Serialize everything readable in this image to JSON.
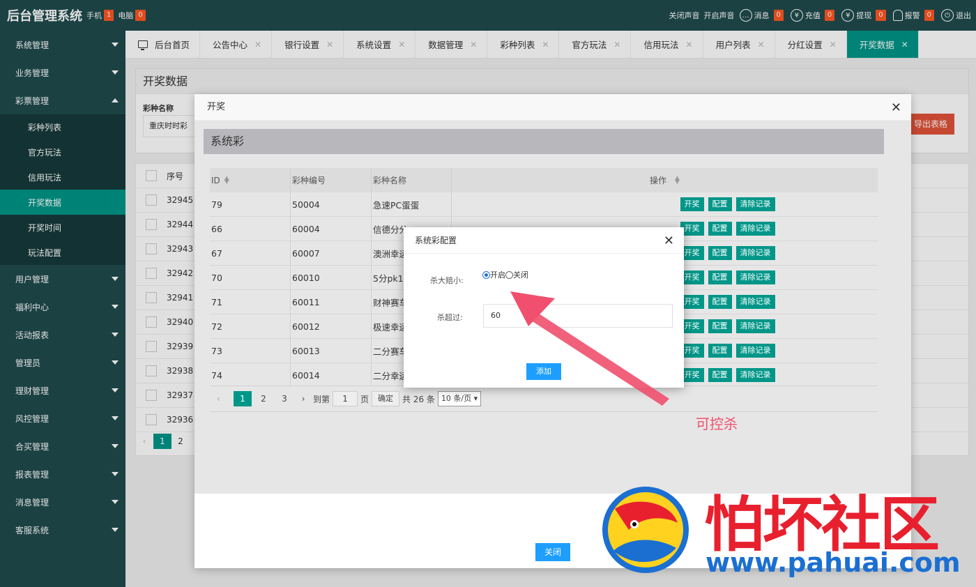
{
  "app": {
    "title": "后台管理系统",
    "mobile_label": "手机",
    "mobile_count": "1",
    "pc_label": "电脑",
    "pc_count": "0"
  },
  "topright": {
    "sound_off": "关闭声音",
    "sound_on": "开启声音",
    "message_label": "消息",
    "message_count": "0",
    "recharge_label": "充值",
    "recharge_count": "0",
    "withdraw_label": "提现",
    "withdraw_count": "0",
    "alarm_label": "报警",
    "alarm_count": "0",
    "logout_label": "退出"
  },
  "sidebar": {
    "items": [
      {
        "label": "系统管理"
      },
      {
        "label": "业务管理"
      },
      {
        "label": "彩票管理"
      },
      {
        "label": "用户管理"
      },
      {
        "label": "福利中心"
      },
      {
        "label": "活动报表"
      },
      {
        "label": "管理员"
      },
      {
        "label": "理财管理"
      },
      {
        "label": "风控管理"
      },
      {
        "label": "合买管理"
      },
      {
        "label": "报表管理"
      },
      {
        "label": "消息管理"
      },
      {
        "label": "客服系统"
      }
    ],
    "submenu": [
      "彩种列表",
      "官方玩法",
      "信用玩法",
      "开奖数据",
      "开奖时间",
      "玩法配置"
    ]
  },
  "tabs": [
    "后台首页",
    "公告中心",
    "银行设置",
    "系统设置",
    "数据管理",
    "彩种列表",
    "官方玩法",
    "信用玩法",
    "用户列表",
    "分红设置",
    "开奖数据"
  ],
  "page": {
    "title": "开奖数据",
    "filter_label": "彩种名称",
    "filter_value": "重庆时时彩",
    "export_label": "导出表格",
    "col_seq": "序号",
    "rows": [
      "32945",
      "32944",
      "32943",
      "32942",
      "32941",
      "32940",
      "32939",
      "32938",
      "32937",
      "32936"
    ],
    "pager": [
      "1",
      "2"
    ]
  },
  "modal": {
    "title": "开奖",
    "section_title": "系统彩",
    "headers": {
      "id": "ID",
      "code": "彩种编号",
      "name": "彩种名称",
      "op": "操作"
    },
    "rows": [
      {
        "id": "79",
        "code": "50004",
        "name": "急速PC蛋蛋"
      },
      {
        "id": "66",
        "code": "60004",
        "name": "信德分分..."
      },
      {
        "id": "67",
        "code": "60007",
        "name": "澳洲幸运"
      },
      {
        "id": "70",
        "code": "60010",
        "name": "5分pk10"
      },
      {
        "id": "71",
        "code": "60011",
        "name": "财神赛车"
      },
      {
        "id": "72",
        "code": "60012",
        "name": "极速幸运"
      },
      {
        "id": "73",
        "code": "60013",
        "name": "二分赛车"
      },
      {
        "id": "74",
        "code": "60014",
        "name": "二分幸运"
      }
    ],
    "btn_draw": "开奖",
    "btn_config": "配置",
    "btn_clear": "清除记录",
    "pager": {
      "pages": [
        "1",
        "2",
        "3"
      ],
      "goto_label": "到第",
      "goto_value": "1",
      "page_label": "页",
      "confirm_label": "确定",
      "total": "共 26 条",
      "per_page": "10 条/页"
    },
    "close_label": "关闭"
  },
  "dialog": {
    "title": "系统彩配置",
    "kill_label": "杀大赔小:",
    "opt_on": "开启",
    "opt_off": "关闭",
    "exceed_label": "杀超过:",
    "exceed_value": "60",
    "add_label": "添加"
  },
  "annotation": "可控杀",
  "watermark": {
    "text": "怕坏社区",
    "url": "www.pahuai.com"
  },
  "colors": {
    "sidebar": "#1f4a4d",
    "accent": "#009688",
    "badge": "#ff5722",
    "blue_button": "#1e9fff",
    "annotation": "#f0506e",
    "watermark_red": "#e8202e",
    "watermark_blue": "#1b6fd1"
  }
}
